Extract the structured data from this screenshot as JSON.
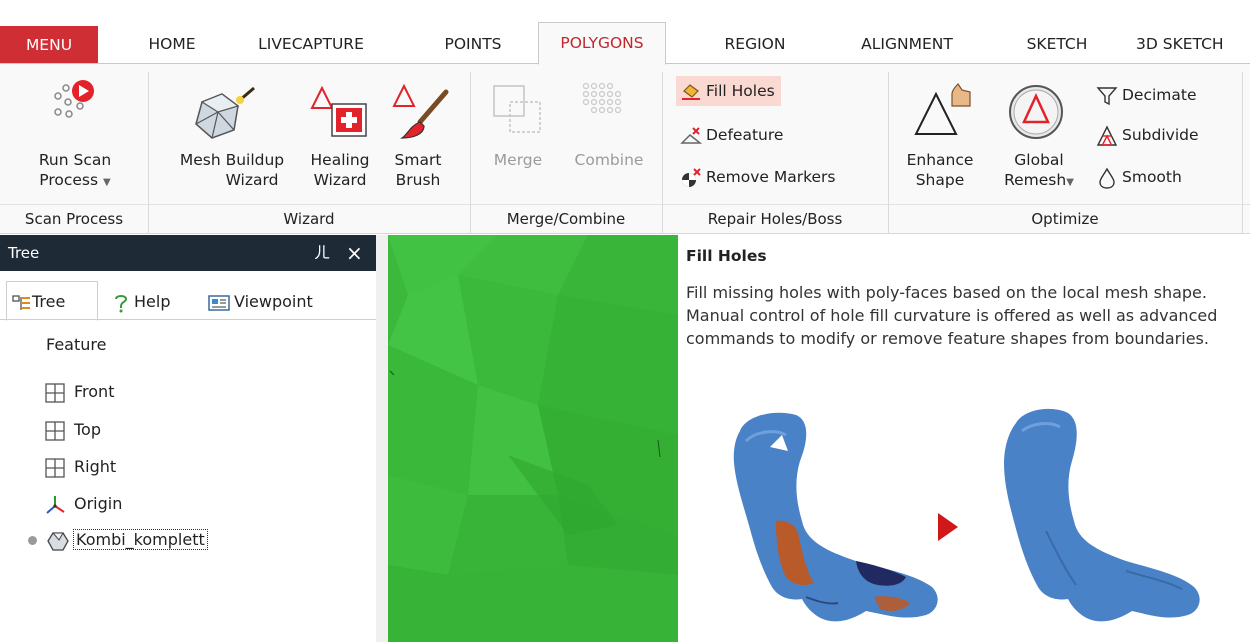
{
  "tabs": {
    "menu": "MENU",
    "home": "HOME",
    "livecapture": "LIVECAPTURE",
    "points": "POINTS",
    "polygons": "POLYGONS",
    "region": "REGION",
    "alignment": "ALIGNMENT",
    "sketch": "SKETCH",
    "sketch3d": "3D SKETCH"
  },
  "ribbon": {
    "scan_process": {
      "btn_line1": "Run Scan",
      "btn_line2": "Process",
      "group": "Scan Process"
    },
    "wizard": {
      "mesh_line1": "Mesh Buildup",
      "mesh_line2": "Wizard",
      "healing_line1": "Healing",
      "healing_line2": "Wizard",
      "smart_line1": "Smart",
      "smart_line2": "Brush",
      "group": "Wizard"
    },
    "merge": {
      "merge": "Merge",
      "combine": "Combine",
      "group": "Merge/Combine"
    },
    "repair": {
      "fill_holes": "Fill Holes",
      "defeature": "Defeature",
      "remove_markers": "Remove Markers",
      "group": "Repair Holes/Boss"
    },
    "optimize": {
      "enhance_line1": "Enhance",
      "enhance_line2": "Shape",
      "remesh_line1": "Global",
      "remesh_line2": "Remesh",
      "decimate": "Decimate",
      "subdivide": "Subdivide",
      "smooth": "Smooth",
      "group": "Optimize"
    }
  },
  "tree_panel": {
    "title": "Tree",
    "pin": "ㄦ",
    "close": "×",
    "tabs": [
      "Tree",
      "Help",
      "Viewpoint"
    ],
    "column_header": "Feature",
    "items": [
      "Front",
      "Top",
      "Right",
      "Origin",
      "Kombi_komplett"
    ]
  },
  "help": {
    "title": "Fill Holes",
    "description": "Fill missing holes with poly-faces based on the local mesh shape. Manual control of hole fill curvature is offered as well as advanced commands to modify or remove feature shapes from boundaries."
  },
  "colors": {
    "menu_bg": "#d02e35",
    "active_tab_text": "#c0282d",
    "panel_header": "#1e2a35",
    "viewport_green": "#3cb83c",
    "mesh_blue": "#4a82c8",
    "hole_orange": "#b85a2a",
    "arrow_red": "#d01818"
  }
}
